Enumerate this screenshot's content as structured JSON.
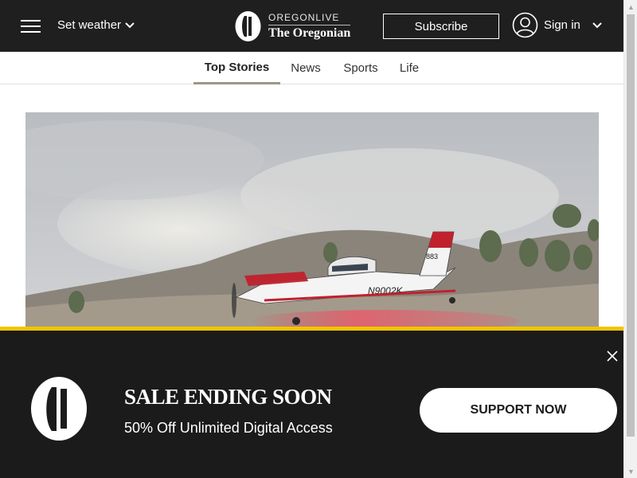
{
  "header": {
    "weather_label": "Set weather",
    "logo_top": "OREGONLIVE",
    "logo_bottom": "The Oregonian",
    "subscribe_label": "Subscribe",
    "signin_label": "Sign in"
  },
  "tabs": [
    {
      "label": "Top Stories",
      "active": true
    },
    {
      "label": "News",
      "active": false
    },
    {
      "label": "Sports",
      "active": false
    },
    {
      "label": "Life",
      "active": false
    }
  ],
  "hero": {
    "plane_tail": "883",
    "plane_reg": "N9002K"
  },
  "promo": {
    "title": "SALE ENDING SOON",
    "subtitle": "50% Off Unlimited Digital Access",
    "button_label": "SUPPORT NOW"
  },
  "colors": {
    "header_bg": "#1f1f1f",
    "promo_accent": "#f2c500",
    "tab_underline": "#9c9783"
  }
}
